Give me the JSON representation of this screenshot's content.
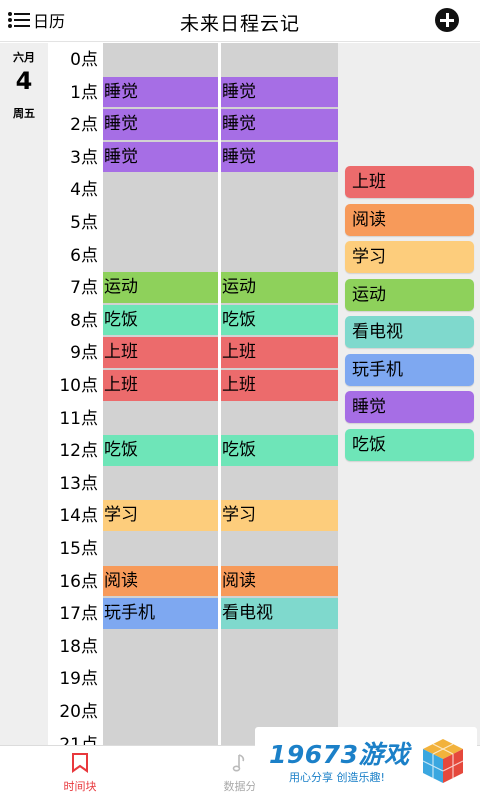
{
  "header": {
    "menu_label": "日历",
    "title": "未来日程云记"
  },
  "date": {
    "month": "六月",
    "day": "4",
    "weekday": "周五"
  },
  "hours": [
    "0点",
    "1点",
    "2点",
    "3点",
    "4点",
    "5点",
    "6点",
    "7点",
    "8点",
    "9点",
    "10点",
    "11点",
    "12点",
    "13点",
    "14点",
    "15点",
    "16点",
    "17点",
    "18点",
    "19点",
    "20点",
    "21点"
  ],
  "schedule": [
    [
      "",
      ""
    ],
    [
      "睡觉",
      "睡觉"
    ],
    [
      "睡觉",
      "睡觉"
    ],
    [
      "睡觉",
      "睡觉"
    ],
    [
      "",
      ""
    ],
    [
      "",
      ""
    ],
    [
      "",
      ""
    ],
    [
      "运动",
      "运动"
    ],
    [
      "吃饭",
      "吃饭"
    ],
    [
      "上班",
      "上班"
    ],
    [
      "上班",
      "上班"
    ],
    [
      "",
      ""
    ],
    [
      "吃饭",
      "吃饭"
    ],
    [
      "",
      ""
    ],
    [
      "学习",
      "学习"
    ],
    [
      "",
      ""
    ],
    [
      "阅读",
      "阅读"
    ],
    [
      "玩手机",
      "看电视"
    ],
    [
      "",
      ""
    ],
    [
      "",
      ""
    ],
    [
      "",
      ""
    ],
    [
      "",
      ""
    ]
  ],
  "categories": [
    {
      "label": "上班",
      "color": "#ec6b6c"
    },
    {
      "label": "阅读",
      "color": "#f79a5a"
    },
    {
      "label": "学习",
      "color": "#fdcd7c"
    },
    {
      "label": "运动",
      "color": "#8ed15b"
    },
    {
      "label": "看电视",
      "color": "#7fd9cd"
    },
    {
      "label": "玩手机",
      "color": "#7ea8f1"
    },
    {
      "label": "睡觉",
      "color": "#a66ee5"
    },
    {
      "label": "吃饭",
      "color": "#6ee5b8"
    }
  ],
  "colors": {
    "empty_cell": "#d2d2d2",
    "accent": "#e8383d",
    "watermark": "#1b80c8"
  },
  "bottom_nav": {
    "tab_timeblock": "时间块",
    "tab_data_partial": "数据分"
  },
  "watermark": {
    "text": "19673游戏",
    "slogan": "用心分享 创造乐趣!"
  }
}
